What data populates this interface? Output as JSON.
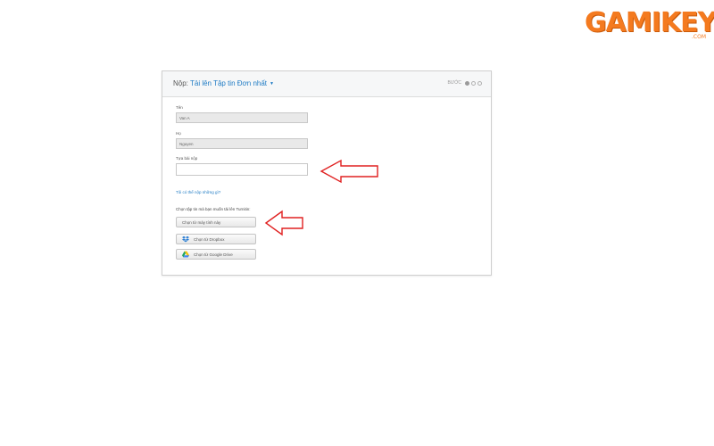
{
  "watermark": {
    "brand": "GAMIKEY",
    "suffix": ".COM"
  },
  "dialog": {
    "title_prefix": "Nộp:",
    "title_link": "Tải lên Tập tin Đơn nhất",
    "steps_label": "BƯỚC",
    "steps": {
      "current": 1,
      "total": 3
    },
    "fields": [
      {
        "label": "Tên",
        "value": "Van A"
      },
      {
        "label": "Họ",
        "value": "Nguyen"
      },
      {
        "label": "Tựa bài nộp",
        "value": ""
      }
    ],
    "help_link": "Tôi có thể nộp những gì?",
    "choose_label": "Chọn tập tin mà bạn muốn tải lên Turnitin:",
    "buttons": {
      "computer": "Chọn từ máy tính này",
      "dropbox": "Chọn từ Dropbox",
      "gdrive": "Chọn từ Google Drive"
    }
  },
  "colors": {
    "link": "#1f7bc4",
    "annotation_arrow": "#e02020",
    "brand": "#f47a1f"
  },
  "icons": [
    "caret-down-icon",
    "step-dot-icon",
    "dropbox-icon",
    "google-drive-icon",
    "arrow-left-annotation-icon"
  ]
}
